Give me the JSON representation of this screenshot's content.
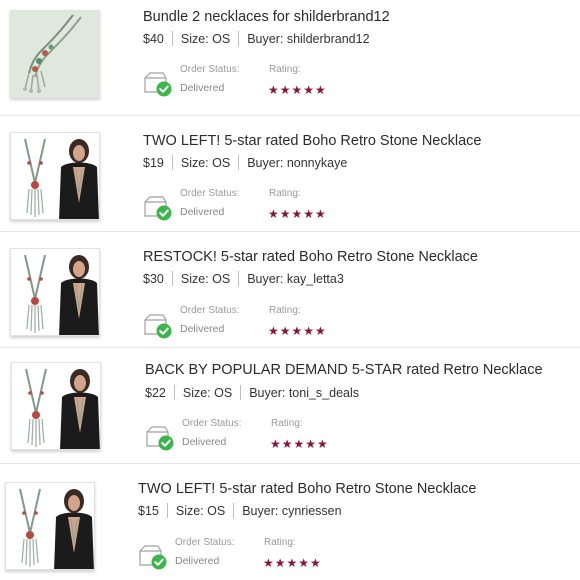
{
  "colors": {
    "star": "#8a1538",
    "check": "#3db54a",
    "divider": "#e6e6e6"
  },
  "labels": {
    "order_status": "Order Status:",
    "rating": "Rating:",
    "size_prefix": "Size:",
    "buyer_prefix": "Buyer:"
  },
  "orders": [
    {
      "title": "Bundle 2 necklaces for shilderbrand12",
      "price": "$40",
      "size": "OS",
      "buyer": "shilderbrand12",
      "status": "Delivered",
      "stars": "★★★★★",
      "rating": 5,
      "image_icon": "necklace-photo-icon"
    },
    {
      "title": "TWO LEFT! 5-star rated Boho Retro Stone Necklace",
      "price": "$19",
      "size": "OS",
      "buyer": "nonnykaye",
      "status": "Delivered",
      "stars": "★★★★★",
      "rating": 5,
      "image_icon": "necklace-model-photo-icon"
    },
    {
      "title": "RESTOCK! 5-star rated Boho Retro Stone Necklace",
      "price": "$30",
      "size": "OS",
      "buyer": "kay_letta3",
      "status": "Delivered",
      "stars": "★★★★★",
      "rating": 5,
      "image_icon": "necklace-model-photo-icon"
    },
    {
      "title": "BACK BY POPULAR DEMAND 5-STAR rated Retro Necklace",
      "price": "$22",
      "size": "OS",
      "buyer": "toni_s_deals",
      "status": "Delivered",
      "stars": "★★★★★",
      "rating": 5,
      "image_icon": "necklace-model-photo-icon"
    },
    {
      "title": "TWO LEFT! 5-star rated Boho Retro Stone Necklace",
      "price": "$15",
      "size": "OS",
      "buyer": "cynriessen",
      "status": "Delivered",
      "stars": "★★★★★",
      "rating": 5,
      "image_icon": "necklace-model-photo-icon"
    }
  ]
}
